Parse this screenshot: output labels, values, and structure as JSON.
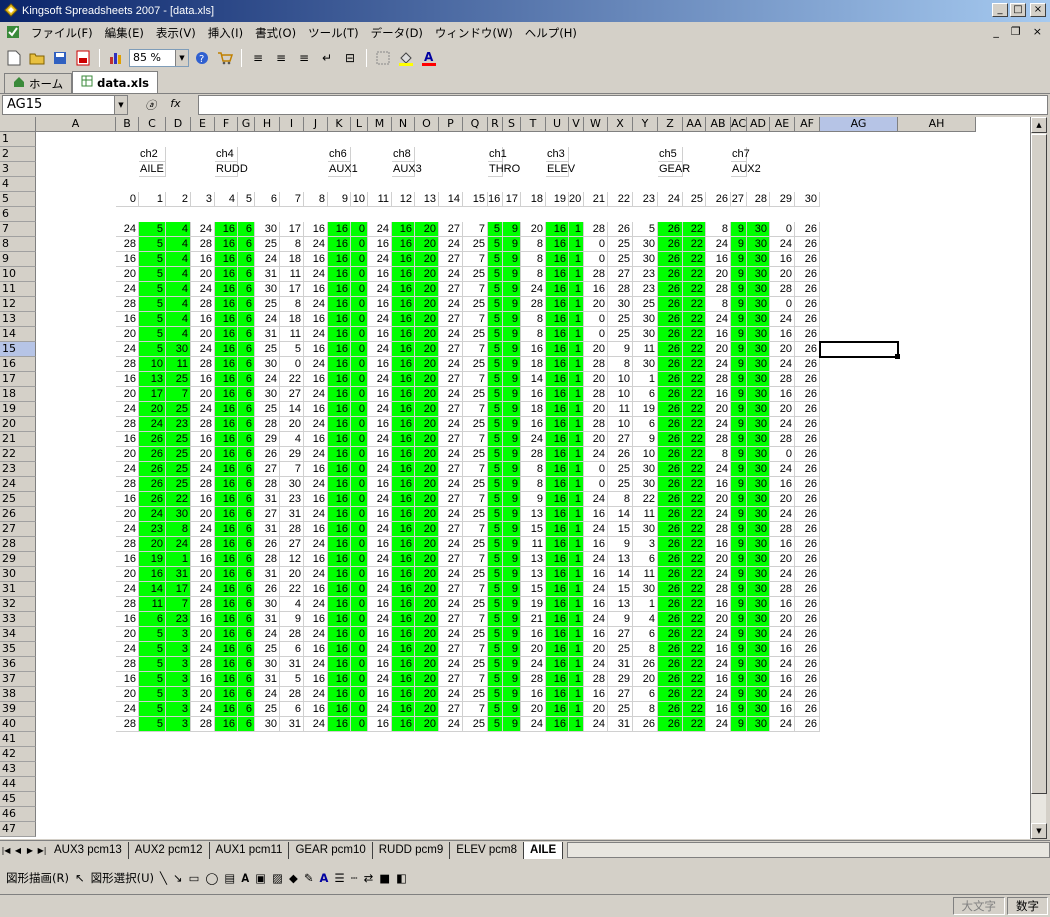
{
  "window": {
    "title": "Kingsoft Spreadsheets 2007 - [data.xls]"
  },
  "menu": [
    "ファイル(F)",
    "編集(E)",
    "表示(V)",
    "挿入(I)",
    "書式(O)",
    "ツール(T)",
    "データ(D)",
    "ウィンドウ(W)",
    "ヘルプ(H)"
  ],
  "toolbar": {
    "zoom": "85 %"
  },
  "doc_tabs": [
    {
      "label": "ホーム",
      "icon": "home-icon"
    },
    {
      "label": "data.xls",
      "icon": "spreadsheet-icon"
    }
  ],
  "formula_bar": {
    "cell_ref": "AG15",
    "fx_label": "fx",
    "content": ""
  },
  "columns": [
    "A",
    "B",
    "C",
    "D",
    "E",
    "F",
    "G",
    "H",
    "I",
    "J",
    "K",
    "L",
    "M",
    "N",
    "O",
    "P",
    "Q",
    "R",
    "S",
    "T",
    "U",
    "V",
    "W",
    "X",
    "Y",
    "Z",
    "AA",
    "AB",
    "AC",
    "AD",
    "AE",
    "AF",
    "AG",
    "AH"
  ],
  "row_numbers": [
    "1",
    "2",
    "3",
    "4",
    "5",
    "6",
    "7",
    "8",
    "9",
    "10",
    "11",
    "12",
    "13",
    "14",
    "15",
    "16",
    "17",
    "18",
    "19",
    "20",
    "21",
    "22",
    "23",
    "24",
    "25",
    "26",
    "27",
    "28",
    "29",
    "30",
    "31",
    "32",
    "33",
    "34",
    "35",
    "36",
    "37",
    "38",
    "39",
    "40",
    "41",
    "42",
    "43",
    "44",
    "45",
    "46",
    "47"
  ],
  "green_columns": [
    "C",
    "D",
    "F",
    "G",
    "K",
    "L",
    "N",
    "O",
    "R",
    "S",
    "U",
    "V",
    "Z",
    "AA",
    "AC",
    "AD"
  ],
  "channel_labels": [
    [
      "C",
      "ch2"
    ],
    [
      "F",
      "ch4"
    ],
    [
      "K",
      "ch6"
    ],
    [
      "N",
      "ch8"
    ],
    [
      "R",
      "ch1"
    ],
    [
      "U",
      "ch3"
    ],
    [
      "Z",
      "ch5"
    ],
    [
      "AC",
      "ch7"
    ]
  ],
  "function_labels": [
    [
      "C",
      "AILE"
    ],
    [
      "F",
      "RUDD"
    ],
    [
      "K",
      "AUX1"
    ],
    [
      "N",
      "AUX3"
    ],
    [
      "R",
      "THRO"
    ],
    [
      "U",
      "ELEV"
    ],
    [
      "Z",
      "GEAR"
    ],
    [
      "AC",
      "AUX2"
    ]
  ],
  "index_row": [
    "0",
    "1",
    "2",
    "3",
    "4",
    "5",
    "6",
    "7",
    "8",
    "9",
    "10",
    "11",
    "12",
    "13",
    "14",
    "15",
    "16",
    "17",
    "18",
    "19",
    "20",
    "21",
    "22",
    "23",
    "24",
    "25",
    "26",
    "27",
    "28",
    "29",
    "30"
  ],
  "data_rows": [
    [
      "24",
      "5",
      "4",
      "24",
      "16",
      "6",
      "30",
      "17",
      "16",
      "16",
      "0",
      "24",
      "16",
      "20",
      "27",
      "7",
      "5",
      "9",
      "20",
      "16",
      "1",
      "28",
      "26",
      "5",
      "26",
      "22",
      "8",
      "9",
      "30",
      "0",
      "26"
    ],
    [
      "28",
      "5",
      "4",
      "28",
      "16",
      "6",
      "25",
      "8",
      "24",
      "16",
      "0",
      "16",
      "16",
      "20",
      "24",
      "25",
      "5",
      "9",
      "8",
      "16",
      "1",
      "0",
      "25",
      "30",
      "26",
      "22",
      "24",
      "9",
      "30",
      "24",
      "26"
    ],
    [
      "16",
      "5",
      "4",
      "16",
      "16",
      "6",
      "24",
      "18",
      "16",
      "16",
      "0",
      "24",
      "16",
      "20",
      "27",
      "7",
      "5",
      "9",
      "8",
      "16",
      "1",
      "0",
      "25",
      "30",
      "26",
      "22",
      "16",
      "9",
      "30",
      "16",
      "26"
    ],
    [
      "20",
      "5",
      "4",
      "20",
      "16",
      "6",
      "31",
      "11",
      "24",
      "16",
      "0",
      "16",
      "16",
      "20",
      "24",
      "25",
      "5",
      "9",
      "8",
      "16",
      "1",
      "28",
      "27",
      "23",
      "26",
      "22",
      "20",
      "9",
      "30",
      "20",
      "26"
    ],
    [
      "24",
      "5",
      "4",
      "24",
      "16",
      "6",
      "30",
      "17",
      "16",
      "16",
      "0",
      "24",
      "16",
      "20",
      "27",
      "7",
      "5",
      "9",
      "24",
      "16",
      "1",
      "16",
      "28",
      "23",
      "26",
      "22",
      "28",
      "9",
      "30",
      "28",
      "26"
    ],
    [
      "28",
      "5",
      "4",
      "28",
      "16",
      "6",
      "25",
      "8",
      "24",
      "16",
      "0",
      "16",
      "16",
      "20",
      "24",
      "25",
      "5",
      "9",
      "28",
      "16",
      "1",
      "20",
      "30",
      "25",
      "26",
      "22",
      "8",
      "9",
      "30",
      "0",
      "26"
    ],
    [
      "16",
      "5",
      "4",
      "16",
      "16",
      "6",
      "24",
      "18",
      "16",
      "16",
      "0",
      "24",
      "16",
      "20",
      "27",
      "7",
      "5",
      "9",
      "8",
      "16",
      "1",
      "0",
      "25",
      "30",
      "26",
      "22",
      "24",
      "9",
      "30",
      "24",
      "26"
    ],
    [
      "20",
      "5",
      "4",
      "20",
      "16",
      "6",
      "31",
      "11",
      "24",
      "16",
      "0",
      "16",
      "16",
      "20",
      "24",
      "25",
      "5",
      "9",
      "8",
      "16",
      "1",
      "0",
      "25",
      "30",
      "26",
      "22",
      "16",
      "9",
      "30",
      "16",
      "26"
    ],
    [
      "24",
      "5",
      "30",
      "24",
      "16",
      "6",
      "25",
      "5",
      "16",
      "16",
      "0",
      "24",
      "16",
      "20",
      "27",
      "7",
      "5",
      "9",
      "16",
      "16",
      "1",
      "20",
      "9",
      "11",
      "26",
      "22",
      "20",
      "9",
      "30",
      "20",
      "26"
    ],
    [
      "28",
      "10",
      "11",
      "28",
      "16",
      "6",
      "30",
      "0",
      "24",
      "16",
      "0",
      "16",
      "16",
      "20",
      "24",
      "25",
      "5",
      "9",
      "18",
      "16",
      "1",
      "28",
      "8",
      "30",
      "26",
      "22",
      "24",
      "9",
      "30",
      "24",
      "26"
    ],
    [
      "16",
      "13",
      "25",
      "16",
      "16",
      "6",
      "24",
      "22",
      "16",
      "16",
      "0",
      "24",
      "16",
      "20",
      "27",
      "7",
      "5",
      "9",
      "14",
      "16",
      "1",
      "20",
      "10",
      "1",
      "26",
      "22",
      "28",
      "9",
      "30",
      "28",
      "26"
    ],
    [
      "20",
      "17",
      "7",
      "20",
      "16",
      "6",
      "30",
      "27",
      "24",
      "16",
      "0",
      "16",
      "16",
      "20",
      "24",
      "25",
      "5",
      "9",
      "16",
      "16",
      "1",
      "28",
      "10",
      "6",
      "26",
      "22",
      "16",
      "9",
      "30",
      "16",
      "26"
    ],
    [
      "24",
      "20",
      "25",
      "24",
      "16",
      "6",
      "25",
      "14",
      "16",
      "16",
      "0",
      "24",
      "16",
      "20",
      "27",
      "7",
      "5",
      "9",
      "18",
      "16",
      "1",
      "20",
      "11",
      "19",
      "26",
      "22",
      "20",
      "9",
      "30",
      "20",
      "26"
    ],
    [
      "28",
      "24",
      "23",
      "28",
      "16",
      "6",
      "28",
      "20",
      "24",
      "16",
      "0",
      "16",
      "16",
      "20",
      "24",
      "25",
      "5",
      "9",
      "16",
      "16",
      "1",
      "28",
      "10",
      "6",
      "26",
      "22",
      "24",
      "9",
      "30",
      "24",
      "26"
    ],
    [
      "16",
      "26",
      "25",
      "16",
      "16",
      "6",
      "29",
      "4",
      "16",
      "16",
      "0",
      "24",
      "16",
      "20",
      "27",
      "7",
      "5",
      "9",
      "24",
      "16",
      "1",
      "20",
      "27",
      "9",
      "26",
      "22",
      "28",
      "9",
      "30",
      "28",
      "26"
    ],
    [
      "20",
      "26",
      "25",
      "20",
      "16",
      "6",
      "26",
      "29",
      "24",
      "16",
      "0",
      "16",
      "16",
      "20",
      "24",
      "25",
      "5",
      "9",
      "28",
      "16",
      "1",
      "24",
      "26",
      "10",
      "26",
      "22",
      "8",
      "9",
      "30",
      "0",
      "26"
    ],
    [
      "24",
      "26",
      "25",
      "24",
      "16",
      "6",
      "27",
      "7",
      "16",
      "16",
      "0",
      "24",
      "16",
      "20",
      "27",
      "7",
      "5",
      "9",
      "8",
      "16",
      "1",
      "0",
      "25",
      "30",
      "26",
      "22",
      "24",
      "9",
      "30",
      "24",
      "26"
    ],
    [
      "28",
      "26",
      "25",
      "28",
      "16",
      "6",
      "28",
      "30",
      "24",
      "16",
      "0",
      "16",
      "16",
      "20",
      "24",
      "25",
      "5",
      "9",
      "8",
      "16",
      "1",
      "0",
      "25",
      "30",
      "26",
      "22",
      "16",
      "9",
      "30",
      "16",
      "26"
    ],
    [
      "16",
      "26",
      "22",
      "16",
      "16",
      "6",
      "31",
      "23",
      "16",
      "16",
      "0",
      "24",
      "16",
      "20",
      "27",
      "7",
      "5",
      "9",
      "9",
      "16",
      "1",
      "24",
      "8",
      "22",
      "26",
      "22",
      "20",
      "9",
      "30",
      "20",
      "26"
    ],
    [
      "20",
      "24",
      "30",
      "20",
      "16",
      "6",
      "27",
      "31",
      "24",
      "16",
      "0",
      "16",
      "16",
      "20",
      "24",
      "25",
      "5",
      "9",
      "13",
      "16",
      "1",
      "16",
      "14",
      "11",
      "26",
      "22",
      "24",
      "9",
      "30",
      "24",
      "26"
    ],
    [
      "24",
      "23",
      "8",
      "24",
      "16",
      "6",
      "31",
      "28",
      "16",
      "16",
      "0",
      "24",
      "16",
      "20",
      "27",
      "7",
      "5",
      "9",
      "15",
      "16",
      "1",
      "24",
      "15",
      "30",
      "26",
      "22",
      "28",
      "9",
      "30",
      "28",
      "26"
    ],
    [
      "28",
      "20",
      "24",
      "28",
      "16",
      "6",
      "26",
      "27",
      "24",
      "16",
      "0",
      "16",
      "16",
      "20",
      "24",
      "25",
      "5",
      "9",
      "11",
      "16",
      "1",
      "16",
      "9",
      "3",
      "26",
      "22",
      "16",
      "9",
      "30",
      "16",
      "26"
    ],
    [
      "16",
      "19",
      "1",
      "16",
      "16",
      "6",
      "28",
      "12",
      "16",
      "16",
      "0",
      "24",
      "16",
      "20",
      "27",
      "7",
      "5",
      "9",
      "13",
      "16",
      "1",
      "24",
      "13",
      "6",
      "26",
      "22",
      "20",
      "9",
      "30",
      "20",
      "26"
    ],
    [
      "20",
      "16",
      "31",
      "20",
      "16",
      "6",
      "31",
      "20",
      "24",
      "16",
      "0",
      "16",
      "16",
      "20",
      "24",
      "25",
      "5",
      "9",
      "13",
      "16",
      "1",
      "16",
      "14",
      "11",
      "26",
      "22",
      "24",
      "9",
      "30",
      "24",
      "26"
    ],
    [
      "24",
      "14",
      "17",
      "24",
      "16",
      "6",
      "26",
      "22",
      "16",
      "16",
      "0",
      "24",
      "16",
      "20",
      "27",
      "7",
      "5",
      "9",
      "15",
      "16",
      "1",
      "24",
      "15",
      "30",
      "26",
      "22",
      "28",
      "9",
      "30",
      "28",
      "26"
    ],
    [
      "28",
      "11",
      "7",
      "28",
      "16",
      "6",
      "30",
      "4",
      "24",
      "16",
      "0",
      "16",
      "16",
      "20",
      "24",
      "25",
      "5",
      "9",
      "19",
      "16",
      "1",
      "16",
      "13",
      "1",
      "26",
      "22",
      "16",
      "9",
      "30",
      "16",
      "26"
    ],
    [
      "16",
      "6",
      "23",
      "16",
      "16",
      "6",
      "31",
      "9",
      "16",
      "16",
      "0",
      "24",
      "16",
      "20",
      "27",
      "7",
      "5",
      "9",
      "21",
      "16",
      "1",
      "24",
      "9",
      "4",
      "26",
      "22",
      "20",
      "9",
      "30",
      "20",
      "26"
    ],
    [
      "20",
      "5",
      "3",
      "20",
      "16",
      "6",
      "24",
      "28",
      "24",
      "16",
      "0",
      "16",
      "16",
      "20",
      "24",
      "25",
      "5",
      "9",
      "16",
      "16",
      "1",
      "16",
      "27",
      "6",
      "26",
      "22",
      "24",
      "9",
      "30",
      "24",
      "26"
    ],
    [
      "24",
      "5",
      "3",
      "24",
      "16",
      "6",
      "25",
      "6",
      "16",
      "16",
      "0",
      "24",
      "16",
      "20",
      "27",
      "7",
      "5",
      "9",
      "20",
      "16",
      "1",
      "20",
      "25",
      "8",
      "26",
      "22",
      "16",
      "9",
      "30",
      "16",
      "26"
    ],
    [
      "28",
      "5",
      "3",
      "28",
      "16",
      "6",
      "30",
      "31",
      "24",
      "16",
      "0",
      "16",
      "16",
      "20",
      "24",
      "25",
      "5",
      "9",
      "24",
      "16",
      "1",
      "24",
      "31",
      "26",
      "26",
      "22",
      "24",
      "9",
      "30",
      "24",
      "26"
    ],
    [
      "16",
      "5",
      "3",
      "16",
      "16",
      "6",
      "31",
      "5",
      "16",
      "16",
      "0",
      "24",
      "16",
      "20",
      "27",
      "7",
      "5",
      "9",
      "28",
      "16",
      "1",
      "28",
      "29",
      "20",
      "26",
      "22",
      "16",
      "9",
      "30",
      "16",
      "26"
    ],
    [
      "20",
      "5",
      "3",
      "20",
      "16",
      "6",
      "24",
      "28",
      "24",
      "16",
      "0",
      "16",
      "16",
      "20",
      "24",
      "25",
      "5",
      "9",
      "16",
      "16",
      "1",
      "16",
      "27",
      "6",
      "26",
      "22",
      "24",
      "9",
      "30",
      "24",
      "26"
    ],
    [
      "24",
      "5",
      "3",
      "24",
      "16",
      "6",
      "25",
      "6",
      "16",
      "16",
      "0",
      "24",
      "16",
      "20",
      "27",
      "7",
      "5",
      "9",
      "20",
      "16",
      "1",
      "20",
      "25",
      "8",
      "26",
      "22",
      "16",
      "9",
      "30",
      "16",
      "26"
    ],
    [
      "28",
      "5",
      "3",
      "28",
      "16",
      "6",
      "30",
      "31",
      "24",
      "16",
      "0",
      "16",
      "16",
      "20",
      "24",
      "25",
      "5",
      "9",
      "24",
      "16",
      "1",
      "24",
      "31",
      "26",
      "26",
      "22",
      "24",
      "9",
      "30",
      "24",
      "26"
    ]
  ],
  "sheet_tabs": [
    "AUX3 pcm13",
    "AUX2 pcm12",
    "AUX1 pcm11",
    "GEAR pcm10",
    "RUDD pcm9",
    "ELEV pcm8",
    "AILE"
  ],
  "active_sheet": "AILE",
  "draw_toolbar": {
    "draw_label": "図形描画(R)",
    "select_label": "図形選択(U)"
  },
  "status": [
    "大文字",
    "数字"
  ]
}
